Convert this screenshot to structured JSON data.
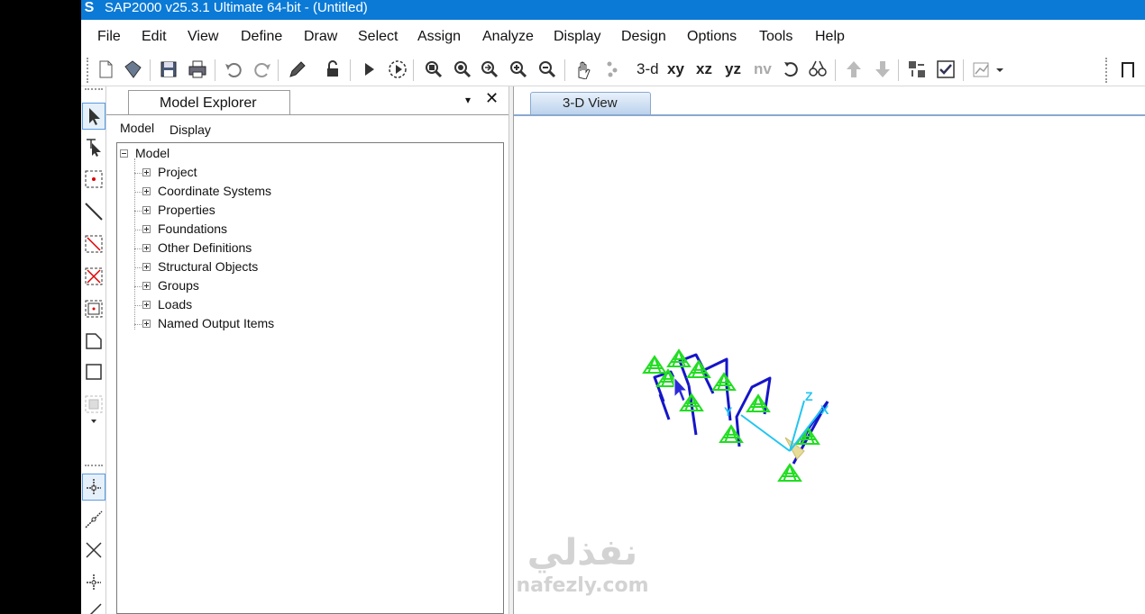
{
  "window": {
    "app_icon": "S",
    "title": "SAP2000 v25.3.1 Ultimate 64-bit - (Untitled)"
  },
  "menu": [
    "File",
    "Edit",
    "View",
    "Define",
    "Draw",
    "Select",
    "Assign",
    "Analyze",
    "Display",
    "Design",
    "Options",
    "Tools",
    "Help"
  ],
  "toolbar": {
    "view_3d": "3-d",
    "view_xy": "xy",
    "view_xz": "xz",
    "view_yz": "yz",
    "view_nv": "nv"
  },
  "explorer": {
    "tab_title": "Model Explorer",
    "pin": "▾",
    "close": "✕",
    "subtabs": {
      "model": "Model",
      "display": "Display"
    },
    "root": "Model",
    "items": [
      "Project",
      "Coordinate Systems",
      "Properties",
      "Foundations",
      "Other Definitions",
      "Structural Objects",
      "Groups",
      "Loads",
      "Named Output Items"
    ]
  },
  "view": {
    "tab_title": "3-D View",
    "axis_labels": {
      "x": "X",
      "y": "Y",
      "z": "Z"
    },
    "colors": {
      "frame": "#1515c8",
      "support": "#22dd22",
      "axis": "#22c5f0"
    }
  },
  "watermark": {
    "arabic": "نفذلي",
    "latin": "nafezly.com"
  }
}
